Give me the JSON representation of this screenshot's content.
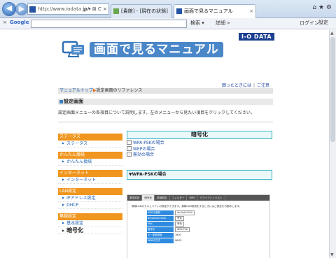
{
  "browser": {
    "address": "http://www.iodata.jp/",
    "address_icons": "ρ ▾ ⊠ C ×",
    "tabs": [
      {
        "label": "[貴館] - [現在の状態]"
      },
      {
        "label": "画面で見るマニュアル"
      }
    ],
    "window_icons": "⌂ ★ ⚙"
  },
  "toolbar": {
    "close": "×",
    "google": "Google",
    "search_button": "検索 ▾",
    "more": "詳細 »",
    "login": "ログイン",
    "settings": "設定"
  },
  "header": {
    "title": "画面で見るマニュアル",
    "brand": "I-O DATA"
  },
  "help_links": [
    "困ったときには",
    "ご注意"
  ],
  "breadcrumb": {
    "home": "マニュアルトップ",
    "current": "設定画面のリファレンス"
  },
  "section_title": "設定画面",
  "intro": "設定画面メニューの各項目について説明します。左のメニューから見たい項目をクリックしてください。",
  "sidebar": [
    {
      "category": "ステータス",
      "items": [
        {
          "label": "ステータス"
        }
      ]
    },
    {
      "category": "かんたん接続",
      "items": [
        {
          "label": "かんたん接続"
        }
      ]
    },
    {
      "category": "インターネット",
      "items": [
        {
          "label": "インターネット"
        }
      ]
    },
    {
      "category": "LAN設定",
      "items": [
        {
          "label": "IPアドレス設定"
        },
        {
          "label": "DHCP"
        }
      ]
    },
    {
      "category": "無線設定",
      "items": [
        {
          "label": "基本設定"
        },
        {
          "label": "暗号化"
        }
      ]
    }
  ],
  "content": {
    "heading": "暗号化",
    "links": [
      "WPA-PSKの場合",
      "WEPの場合",
      "無効の場合"
    ],
    "sub_heading": "▼WPA-PSKの場合"
  },
  "screenshot": {
    "tabs": [
      "基本設定",
      "暗号化",
      "詳細設定",
      "フィルター",
      "WPS",
      "クライアントリスト"
    ],
    "description": "無線LANのセキュリティの設定ができます。無線LAN使用をするときにはご設定をお勧めします。",
    "rows": [
      {
        "label": "SSIDの選択",
        "value": "AirPort01000"
      },
      {
        "label": "Broadcast SSID",
        "value": "有効"
      },
      {
        "label": "MAC",
        "value": "有効"
      },
      {
        "label": "暗号化",
        "value": "WPA-PSK"
      },
      {
        "label": "キー更新間隔",
        "value": "1800"
      },
      {
        "label": "WPAの方式",
        "value": "WPA2"
      }
    ]
  }
}
